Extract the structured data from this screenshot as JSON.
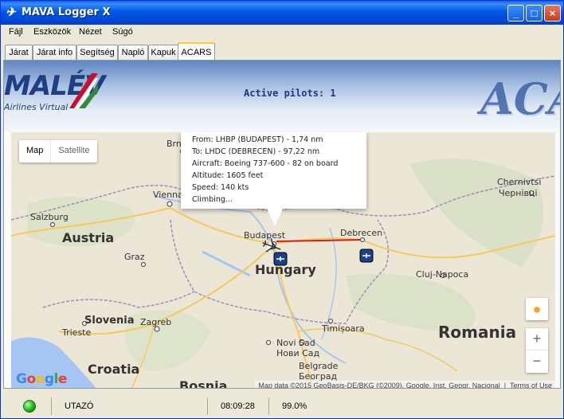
{
  "window": {
    "title": "MAVA Logger X",
    "controls": [
      "minimize",
      "maximize",
      "close"
    ]
  },
  "menu": [
    "Fájl",
    "Eszközök",
    "Nézet",
    "Súgó"
  ],
  "tabs": [
    {
      "label": "Járat",
      "active": false
    },
    {
      "label": "Járat info",
      "active": false
    },
    {
      "label": "Segítség",
      "active": false
    },
    {
      "label": "Napló",
      "active": false
    },
    {
      "label": "Kapuk",
      "active": false
    },
    {
      "label": "ACARS",
      "active": true
    }
  ],
  "banner": {
    "logo_text": "MALÉV",
    "logo_sub": "Airlines Virtual",
    "active_pilots": "Active pilots: 1",
    "watermark": "ACARS"
  },
  "map": {
    "map_type": {
      "map": "Map",
      "satellite": "Satellite",
      "selected": "Map"
    },
    "info": {
      "from": "From: LHBP (BUDAPEST) - 1,74 nm",
      "to": "To: LHDC (DEBRECEN) - 97,22 nm",
      "aircraft": "Aircraft: Boeing 737-600 - 82 on board",
      "altitude": "Altitude: 1605 feet",
      "speed": "Speed: 140 kts",
      "status": "Climbing..."
    },
    "labels": {
      "brno": "Brno",
      "vienna": "Vienna",
      "salzburg": "Salzburg",
      "austria": "Austria",
      "graz": "Graz",
      "budapest": "Budapest",
      "debrecen": "Debrecen",
      "hungary": "Hungary",
      "chernivtsi": "Chernivtsi",
      "chernivtsi_ua": "Чернівці",
      "cluj": "Cluj-Napoca",
      "slovenia": "Slovenia",
      "zagreb": "Zagreb",
      "trieste": "Trieste",
      "timisoara": "Timișoara",
      "novi_sad": "Novi Sad",
      "novi_sad_sr": "Нови Сад",
      "belgrade": "Belgrade",
      "belgrade_sr": "Београд",
      "croatia": "Croatia",
      "bosnia": "Bosnia",
      "romania": "Romania"
    },
    "google": "Google",
    "attribution": "Map data ©2015 GeoBasis-DE/BKG (©2009), Google, Inst. Geogr. Nacional",
    "terms": "Terms of Use",
    "zoom_in": "+",
    "zoom_out": "−",
    "colors": {
      "route": "#cc2222",
      "water": "#a5c6f3",
      "land": "#e9e3d6"
    }
  },
  "status": {
    "connection": "green",
    "phase": "UTAZÓ",
    "time": "08:09:28",
    "percent": "99.0%"
  }
}
